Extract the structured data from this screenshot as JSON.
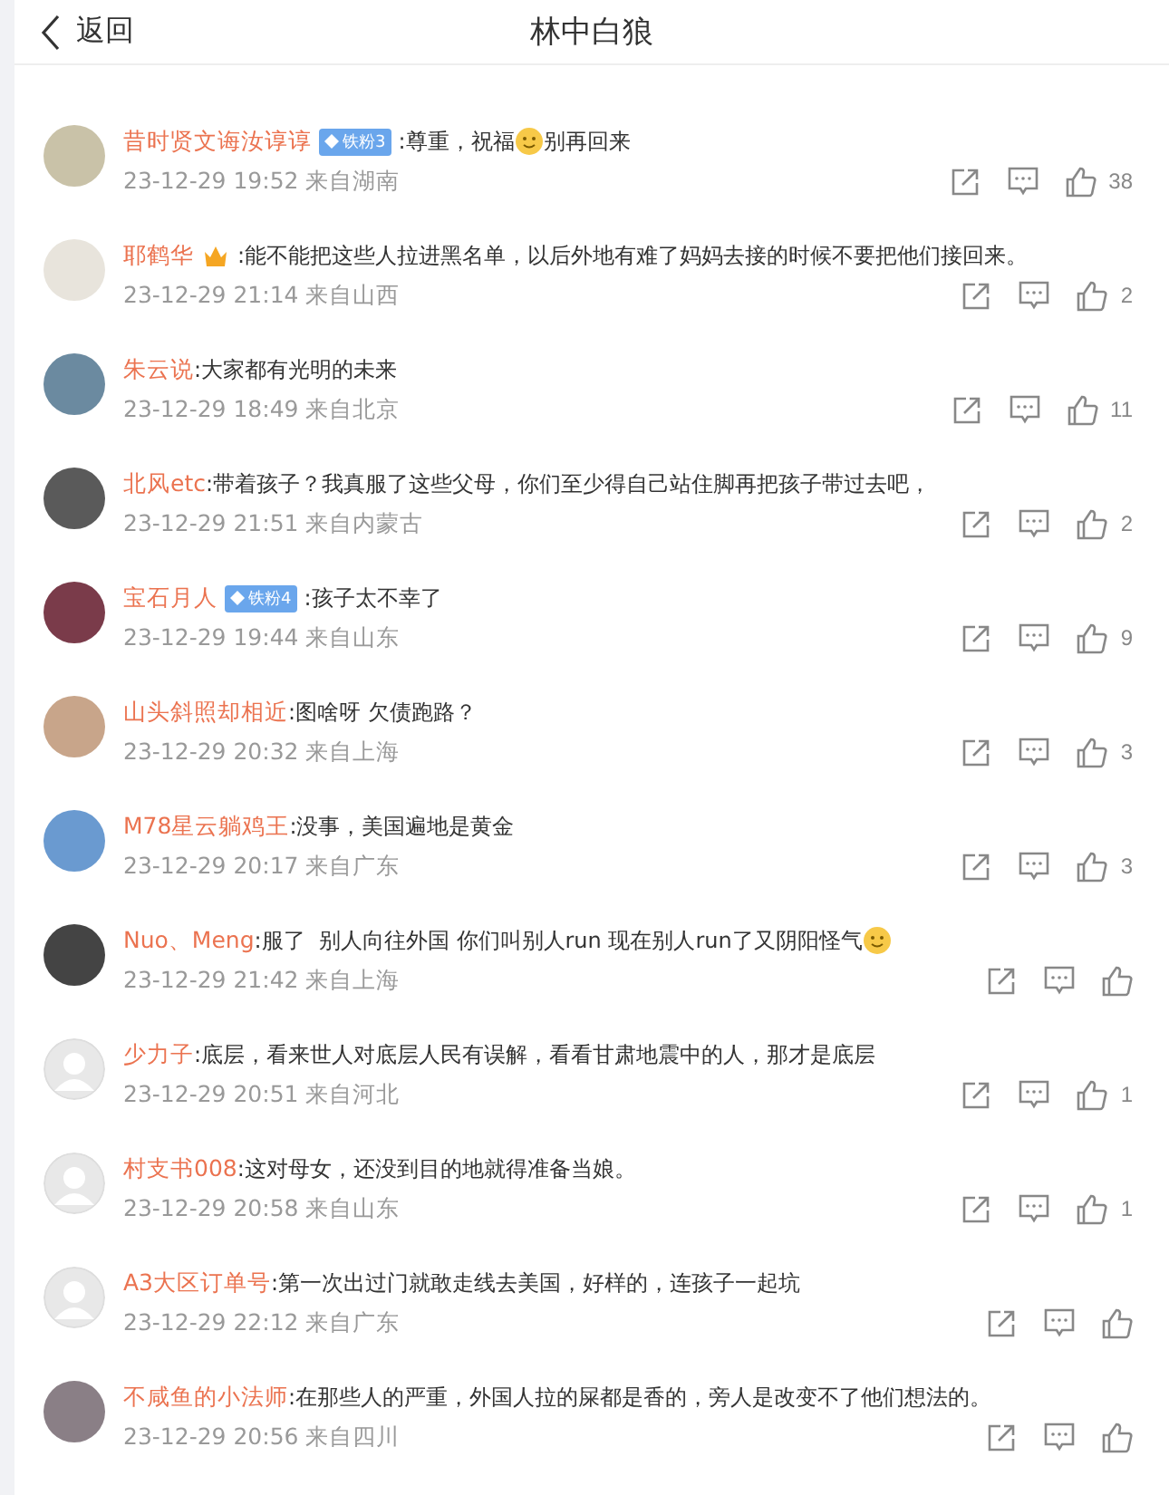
{
  "header": {
    "back_label": "返回",
    "title": "林中白狼"
  },
  "comments": [
    {
      "kind": "photo",
      "name": "昔时贤文诲汝谆谆",
      "badge": {
        "kind": "fan",
        "label": "铁粉3"
      },
      "content": [
        {
          "kind": "text",
          "text": ":尊重，祝福"
        },
        {
          "kind": "emoji"
        },
        {
          "kind": "text",
          "text": "别再回来"
        }
      ],
      "meta": "23-12-29 19:52 来自湖南",
      "likes": "38"
    },
    {
      "kind": "photo",
      "name": "耶鹤华",
      "badge": {
        "kind": "crown"
      },
      "content": [
        {
          "kind": "text",
          "text": ":能不能把这些人拉进黑名单，以后外地有难了妈妈去接的时候不要把他们接回来。"
        }
      ],
      "meta": "23-12-29 21:14 来自山西",
      "likes": "2"
    },
    {
      "kind": "photo",
      "name": "朱云说",
      "content": [
        {
          "kind": "text",
          "text": ":大家都有光明的未来"
        }
      ],
      "meta": "23-12-29 18:49 来自北京",
      "likes": "11"
    },
    {
      "kind": "photo",
      "name": "北风etc",
      "content": [
        {
          "kind": "text",
          "text": ":带着孩子？我真服了这些父母，你们至少得自己站住脚再把孩子带过去吧，"
        }
      ],
      "meta": "23-12-29 21:51 来自内蒙古",
      "likes": "2"
    },
    {
      "kind": "photo",
      "name": "宝石月人",
      "badge": {
        "kind": "fan",
        "label": "铁粉4"
      },
      "content": [
        {
          "kind": "text",
          "text": ":孩子太不幸了"
        }
      ],
      "meta": "23-12-29 19:44 来自山东",
      "likes": "9"
    },
    {
      "kind": "photo",
      "name": "山头斜照却相近",
      "content": [
        {
          "kind": "text",
          "text": ":图啥呀 欠债跑路？"
        }
      ],
      "meta": "23-12-29 20:32 来自上海",
      "likes": "3"
    },
    {
      "kind": "photo",
      "name": "M78星云躺鸡王",
      "content": [
        {
          "kind": "text",
          "text": ":没事，美国遍地是黄金"
        }
      ],
      "meta": "23-12-29 20:17 来自广东",
      "likes": "3"
    },
    {
      "kind": "photo",
      "name": "Nuo、Meng",
      "content": [
        {
          "kind": "text",
          "text": ":服了  别人向往外国 你们叫别人run 现在别人run了又阴阳怪气"
        },
        {
          "kind": "emoji"
        }
      ],
      "meta": "23-12-29 21:42 来自上海"
    },
    {
      "kind": "default",
      "name": "少力子",
      "content": [
        {
          "kind": "text",
          "text": ":底层，看来世人对底层人民有误解，看看甘肃地震中的人，那才是底层"
        }
      ],
      "meta": "23-12-29 20:51 来自河北",
      "likes": "1"
    },
    {
      "kind": "default",
      "name": "村支书008",
      "content": [
        {
          "kind": "text",
          "text": ":这对母女，还没到目的地就得准备当娘。"
        }
      ],
      "meta": "23-12-29 20:58 来自山东",
      "likes": "1"
    },
    {
      "kind": "default",
      "name": "A3大区订单号",
      "content": [
        {
          "kind": "text",
          "text": ":第一次出过门就敢走线去美国，好样的，连孩子一起坑"
        }
      ],
      "meta": "23-12-29 22:12 来自广东"
    },
    {
      "kind": "photo",
      "name": "不咸鱼的小法师",
      "content": [
        {
          "kind": "text",
          "text": ":在那些人的严重，外国人拉的屎都是香的，旁人是改变不了他们想法的。"
        }
      ],
      "meta": "23-12-29 20:56 来自四川"
    }
  ]
}
